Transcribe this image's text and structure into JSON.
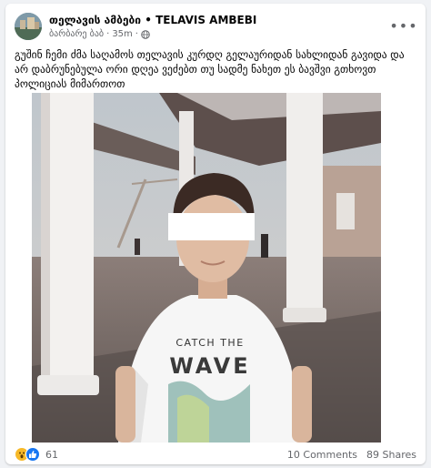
{
  "post": {
    "page_name": "თელავის ამბები • TELAVIS AMBEBI",
    "author": "ბარბარე ბაბ",
    "time": "35m",
    "separator": "·",
    "more_label": "•••",
    "text": "გუშინ ჩემი ძმა საღამოს თელავის კურდღ გელაურიდან სახლიდან გავიდა და არ დაბრუნებულა ორი დღეა ვეძებთ თუ სადმე ნახეთ ეს ბავშვი გთხოვთ პოლიციას მიმართოთ",
    "photo_shirt_text_line1": "CATCH THE",
    "photo_shirt_text_line2": "WAVE"
  },
  "footer": {
    "reaction_count": "61",
    "comments": "10 Comments",
    "shares": "89 Shares"
  },
  "icons": {
    "more": "more-options-icon",
    "globe": "globe-icon",
    "wow": "wow-reaction-icon",
    "like": "like-reaction-icon"
  }
}
